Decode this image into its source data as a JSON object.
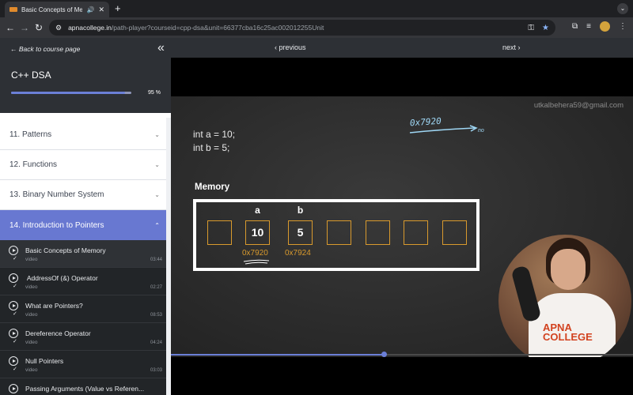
{
  "browser": {
    "tab_title": "Basic Concepts of Memor",
    "url_host": "apnacollege.in",
    "url_path": "/path-player?courseid=cpp-dsa&unit=66377cba16c25ac002012255Unit"
  },
  "sidebar": {
    "back_label": "Back to course page",
    "course_title": "C++ DSA",
    "progress_label": "95 %",
    "progress_value": 0.95,
    "sections": [
      {
        "label": "11. Patterns"
      },
      {
        "label": "12. Functions"
      },
      {
        "label": "13. Binary Number System"
      },
      {
        "label": "14. Introduction to Pointers"
      }
    ],
    "lessons": [
      {
        "title": "Basic Concepts of Memory",
        "type": "video",
        "duration": "03:44"
      },
      {
        "title": " AddressOf (&) Operator",
        "type": "video",
        "duration": "02:27"
      },
      {
        "title": "What are Pointers?",
        "type": "video",
        "duration": "08:53"
      },
      {
        "title": "Dereference Operator",
        "type": "video",
        "duration": "04:24"
      },
      {
        "title": "Null Pointers",
        "type": "video",
        "duration": "03:03"
      },
      {
        "title": "Passing Arguments (Value vs Referen...",
        "type": "video",
        "duration": ""
      }
    ]
  },
  "player": {
    "previous_label": "previous",
    "next_label": "next",
    "seek_progress": 0.46
  },
  "video": {
    "watermark": "utkalbehera59@gmail.com",
    "code_line_1": "int a = 10;",
    "code_line_2": "int b = 5;",
    "hand_addr": "0x7920",
    "hand_note": "no",
    "memory_label": "Memory",
    "cells": [
      {
        "var": "",
        "value": "",
        "addr": ""
      },
      {
        "var": "a",
        "value": "10",
        "addr": "0x7920"
      },
      {
        "var": "b",
        "value": "5",
        "addr": "0x7924"
      },
      {
        "var": "",
        "value": "",
        "addr": ""
      },
      {
        "var": "",
        "value": "",
        "addr": ""
      },
      {
        "var": "",
        "value": "",
        "addr": ""
      },
      {
        "var": "",
        "value": "",
        "addr": ""
      }
    ],
    "presenter_logo": "APNA\nCOLLEGE"
  },
  "colors": {
    "accent": "#6878d1",
    "chalk_orange": "#d99a2d",
    "chalk_blue": "#9fd7f5"
  }
}
